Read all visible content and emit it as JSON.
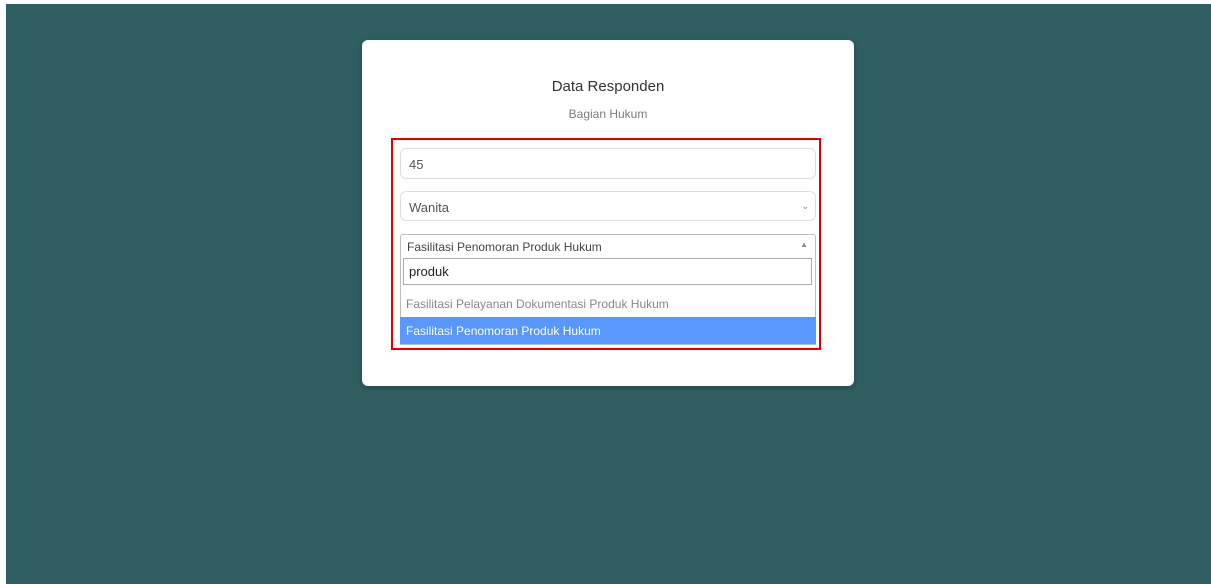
{
  "form": {
    "title": "Data Responden",
    "subtitle": "Bagian Hukum",
    "age_value": "45",
    "gender_value": "Wanita",
    "gender_chevron_icon": "chevron-down-icon",
    "service_selected": "Fasilitasi Penomoran Produk Hukum",
    "service_arrow_icon": "caret-up-icon",
    "search_value": "produk",
    "options": [
      "Fasilitasi Pelayanan Dokumentasi Produk Hukum",
      "Fasilitasi Penomoran Produk Hukum"
    ]
  },
  "colors": {
    "background": "#2f5e61",
    "highlight_border": "#e00000",
    "option_highlight": "#5897fb"
  }
}
